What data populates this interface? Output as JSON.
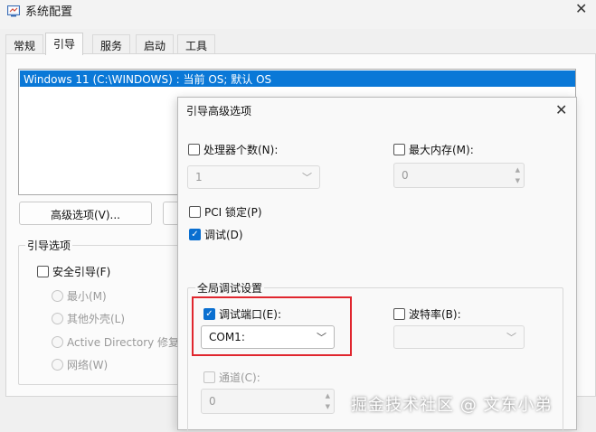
{
  "window": {
    "title": "系统配置",
    "close_glyph": "✕"
  },
  "tabs": [
    {
      "label": "常规"
    },
    {
      "label": "引导"
    },
    {
      "label": "服务"
    },
    {
      "label": "启动"
    },
    {
      "label": "工具"
    }
  ],
  "os_list": {
    "entries": [
      "Windows 11 (C:\\WINDOWS) : 当前 OS; 默认 OS"
    ],
    "selected_index": 0
  },
  "buttons": {
    "advanced_label": "高级选项(V)..."
  },
  "boot_options": {
    "legend": "引导选项",
    "safe_boot_label": "安全引导(F)",
    "radios": [
      "最小(M)",
      "其他外壳(L)",
      "Active Directory 修复(",
      "网络(W)"
    ]
  },
  "dialog": {
    "title": "引导高级选项",
    "close_glyph": "✕",
    "processors": {
      "label": "处理器个数(N):",
      "checked": false,
      "value": "1"
    },
    "max_memory": {
      "label": "最大内存(M):",
      "checked": false,
      "value": "0"
    },
    "pci_lock": {
      "label": "PCI 锁定(P)",
      "checked": false
    },
    "debug": {
      "label": "调试(D)",
      "checked": true
    },
    "global_debug": {
      "legend": "全局调试设置",
      "debug_port": {
        "label": "调试端口(E):",
        "checked": true,
        "value": "COM1:"
      },
      "baud_rate": {
        "label": "波特率(B):",
        "checked": false,
        "value": ""
      },
      "channel": {
        "label": "通道(C):",
        "checked": false,
        "value": "0"
      }
    }
  },
  "highlight_color": "#e0262e",
  "accent_color": "#0a78d7",
  "watermark": "掘金技术社区 @ 文东小弟"
}
